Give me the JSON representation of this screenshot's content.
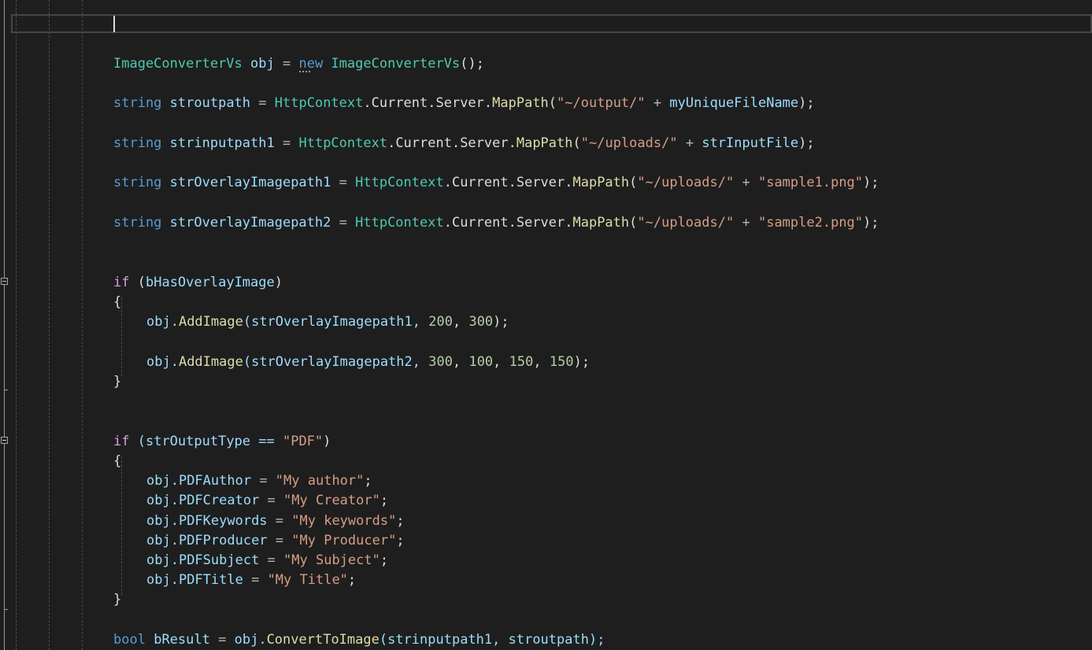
{
  "code": {
    "obj_type_decl": "ImageConverterVs",
    "obj_var": "obj",
    "eq": "=",
    "new_kw": "new",
    "obj_ctor": "ImageConverterVs",
    "ctor_args": "();",
    "string_kw": "string",
    "bool_kw": "bool",
    "if_kw": "if",
    "var_stroutpath": "stroutpath",
    "var_strinputpath1": "strinputpath1",
    "var_overlay1": "strOverlayImagepath1",
    "var_overlay2": "strOverlayImagepath2",
    "httpcontext": "HttpContext",
    "current": ".Current.Server.",
    "mappath": "MapPath",
    "open_paren": "(",
    "plus": "+",
    "close_stmt": ");",
    "str_output_dir": "\"~/output/\"",
    "str_uploads_dir": "\"~/uploads/\"",
    "var_unique_file": "myUniqueFileName",
    "var_input_file": "strInputFile",
    "str_sample1": "\"sample1.png\"",
    "str_sample2": "\"sample2.png\"",
    "cond1_open": "(",
    "cond1_var": "bHasOverlayImage",
    "cond1_close": ")",
    "brace_open": "{",
    "brace_close": "}",
    "obj_dot": "obj.",
    "add_image": "AddImage",
    "add1_args_open": "(strOverlayImagepath1, ",
    "add1_n1": "200",
    "comma": ", ",
    "add1_n2": "300",
    "add2_args_open": "(strOverlayImagepath2, ",
    "add2_n1": "300",
    "add2_n2": "100",
    "add2_n3": "150",
    "add2_n4": "150",
    "cond2_open": "(strOutputType == ",
    "str_pdf": "\"PDF\"",
    "cond2_close": ")",
    "prop_author": "PDFAuthor",
    "prop_creator": "PDFCreator",
    "prop_keywords": "PDFKeywords",
    "prop_producer": "PDFProducer",
    "prop_subject": "PDFSubject",
    "prop_title": "PDFTitle",
    "assign": " = ",
    "semi": ";",
    "str_author": "\"My author\"",
    "str_creator": "\"My Creator\"",
    "str_keywords": "\"My keywords\"",
    "str_producer": "\"My Producer\"",
    "str_subject": "\"My Subject\"",
    "str_title": "\"My Title\"",
    "var_bresult": "bResult",
    "convert_fn": "ConvertToImage",
    "convert_args": "(strinputpath1, stroutpath);"
  },
  "colors": {
    "background": "#1e1e1e",
    "keyword": "#569cd6",
    "control": "#d8a0df",
    "type": "#4ec9b0",
    "method": "#dcdcaa",
    "string": "#d69d85",
    "number": "#b5cea8"
  }
}
